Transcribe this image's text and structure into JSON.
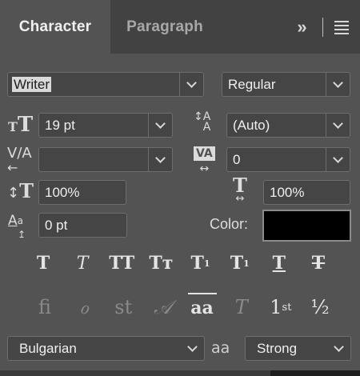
{
  "tabs": [
    {
      "label": "Character",
      "active": true
    },
    {
      "label": "Paragraph",
      "active": false
    }
  ],
  "header": {
    "collapse_glyph": "»",
    "menu_icon": "hamburger-icon"
  },
  "font_family": {
    "value": "Writer"
  },
  "font_style": {
    "value": "Regular"
  },
  "font_size": {
    "value": "19 pt",
    "icon": "font-size-icon"
  },
  "leading": {
    "value": "(Auto)",
    "icon": "leading-icon"
  },
  "kerning": {
    "value": "",
    "icon": "kerning-icon"
  },
  "tracking": {
    "value": "0",
    "icon": "tracking-icon"
  },
  "vertical_scale": {
    "value": "100%",
    "icon": "vertical-scale-icon"
  },
  "horizontal_scale": {
    "value": "100%",
    "icon": "horizontal-scale-icon"
  },
  "baseline_shift": {
    "value": "0 pt",
    "icon": "baseline-shift-icon"
  },
  "color": {
    "label": "Color:",
    "value": "#000000"
  },
  "style_buttons": {
    "faux_bold": "T",
    "faux_italic": "T",
    "all_caps": "TT",
    "small_caps": "Tт",
    "superscript": "T",
    "superscript_mark": "1",
    "subscript": "T",
    "subscript_mark": "1",
    "underline": "T",
    "strikethrough": "T"
  },
  "opentype_buttons": {
    "ligatures": "fi",
    "old_style": "ℴ",
    "discretionary": "st",
    "swash": "𝒜",
    "stylistic": "aa",
    "titling": "T",
    "ordinals": "1",
    "ordinals_mark": "st",
    "fractions": "½"
  },
  "language": {
    "value": "Bulgarian"
  },
  "antialias": {
    "value": "Strong",
    "icon_text": "aa"
  }
}
